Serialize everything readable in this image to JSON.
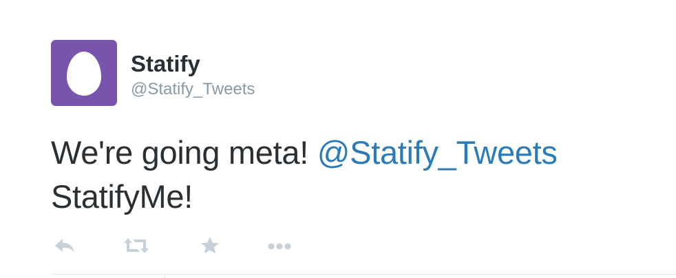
{
  "tweet": {
    "author": {
      "name": "Statify",
      "handle": "@Statify_Tweets",
      "avatar_color": "#7854ad"
    },
    "text": {
      "before_mention": "We're going meta! ",
      "mention": "@Statify_Tweets",
      "after_mention": " StatifyMe!"
    },
    "actions": [
      {
        "icon": "reply-icon"
      },
      {
        "icon": "retweet-icon"
      },
      {
        "icon": "favorite-star-icon"
      },
      {
        "icon": "more-dots-icon"
      }
    ],
    "colors": {
      "text": "#292f33",
      "handle": "#8899a6",
      "mention": "#2b7bb9",
      "action_icon": "#c6d1da"
    }
  }
}
